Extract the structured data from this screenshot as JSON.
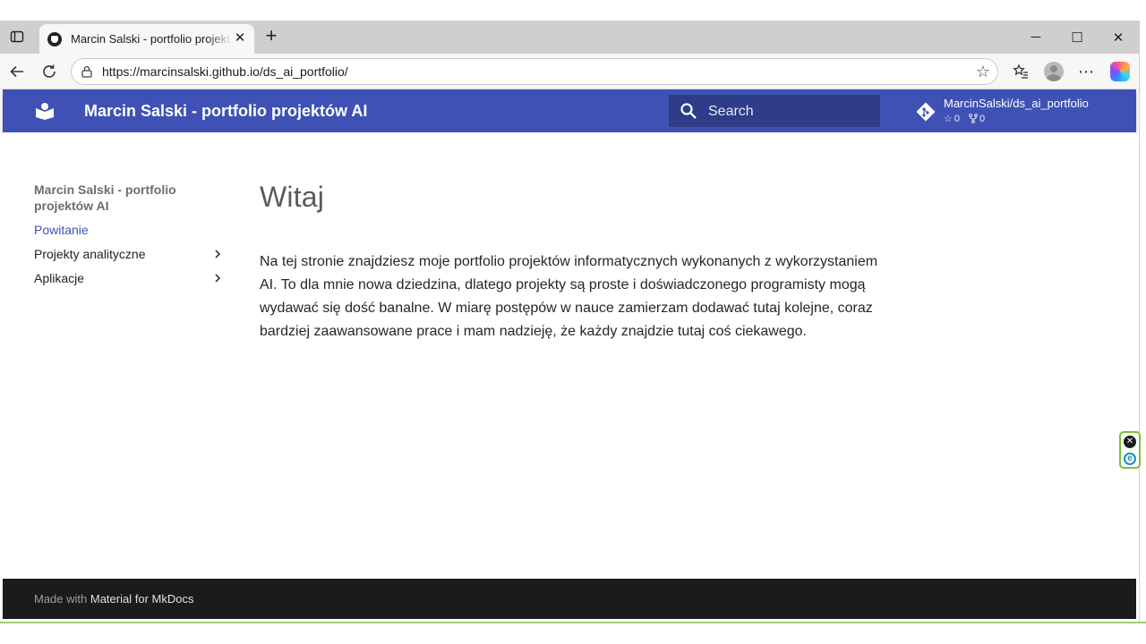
{
  "browser": {
    "tab": {
      "title": "Marcin Salski - portfolio projektów AI",
      "favicon": "site-favicon-icon"
    },
    "new_tab": "+",
    "window_controls": {
      "minimize": "─",
      "maximize": "☐",
      "close": "✕"
    },
    "address_bar": {
      "url": "https://marcinsalski.github.io/ds_ai_portfolio/"
    }
  },
  "header": {
    "title": "Marcin Salski - portfolio projektów AI",
    "search": {
      "placeholder": "Search"
    },
    "repo": {
      "name": "MarcinSalski/ds_ai_portfolio",
      "stars": "0",
      "forks": "0"
    },
    "accent_color": "#3f51b5"
  },
  "nav": {
    "title": "Marcin Salski - portfolio projektów AI",
    "items": [
      {
        "label": "Powitanie",
        "active": true
      },
      {
        "label": "Projekty analityczne",
        "active": false
      },
      {
        "label": "Aplikacje",
        "active": false
      }
    ]
  },
  "page": {
    "heading": "Witaj",
    "paragraph": "Na tej stronie znajdziesz moje portfolio projektów informatycznych wykonanych z wykorzystaniem AI. To dla mnie nowa dziedzina, dlatego projekty są proste i doświadczonego programisty mogą wydawać się dość banalne. W miarę postępów w nauce zamierzam dodawać tutaj kolejne, coraz bardziej zaawansowane prace i mam nadzieję, że każdy znajdzie tutaj coś ciekawego."
  },
  "footer": {
    "made_with": "Made with",
    "link": "Material for MkDocs"
  }
}
